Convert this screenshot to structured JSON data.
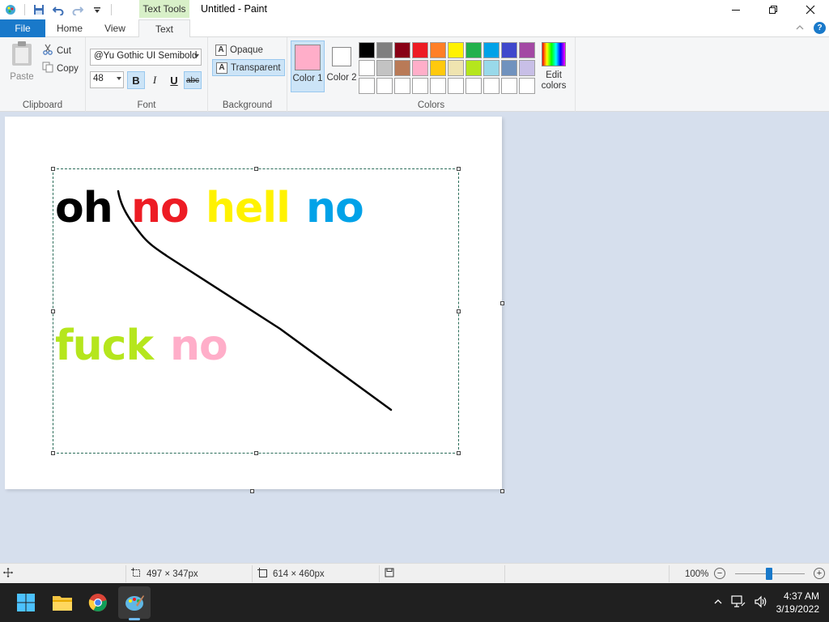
{
  "window": {
    "title": "Untitled - Paint",
    "context_tab": "Text Tools",
    "controls": {
      "minimize": "—",
      "restore": "❐",
      "close": "✕"
    }
  },
  "tabs": {
    "file": "File",
    "home": "Home",
    "view": "View",
    "text": "Text"
  },
  "ribbon": {
    "clipboard": {
      "label": "Clipboard",
      "paste": "Paste",
      "cut": "Cut",
      "copy": "Copy"
    },
    "font": {
      "label": "Font",
      "family": "@Yu Gothic UI Semibold",
      "size": "48",
      "bold": "B",
      "italic": "I",
      "underline": "U",
      "strikethrough": "abc"
    },
    "background": {
      "label": "Background",
      "opaque": "Opaque",
      "transparent": "Transparent",
      "selected": "transparent"
    },
    "colors": {
      "label": "Colors",
      "color1_label": "Color 1",
      "color2_label": "Color 2",
      "color1": "#ffaec9",
      "color2": "#ffffff",
      "edit_colors": "Edit colors",
      "palette": [
        "#000000",
        "#7f7f7f",
        "#880015",
        "#ed1c24",
        "#ff7f27",
        "#fff200",
        "#22b14c",
        "#00a2e8",
        "#3f48cc",
        "#a349a4",
        "#ffffff",
        "#c3c3c3",
        "#b97a57",
        "#ffaec9",
        "#ffc90e",
        "#efe4b0",
        "#b5e61d",
        "#99d9ea",
        "#7092be",
        "#c8bfe7",
        "#ffffff",
        "#ffffff",
        "#ffffff",
        "#ffffff",
        "#ffffff",
        "#ffffff",
        "#ffffff",
        "#ffffff",
        "#ffffff",
        "#ffffff"
      ]
    }
  },
  "canvas": {
    "lines": [
      [
        {
          "text": "oh",
          "color": "#000000"
        },
        {
          "text": "no",
          "color": "#ed1c24"
        },
        {
          "text": "hell",
          "color": "#fff200"
        },
        {
          "text": "no",
          "color": "#00a2e8"
        }
      ],
      [
        {
          "text": "fuck",
          "color": "#b5e61d"
        },
        {
          "text": "no",
          "color": "#ffaec9"
        }
      ]
    ],
    "stroke_color": "#000000"
  },
  "status": {
    "selection_size": "497 × 347px",
    "canvas_size": "614 × 460px",
    "zoom": "100%",
    "zoom_minus": "−",
    "zoom_plus": "+"
  },
  "taskbar": {
    "time": "4:37 AM",
    "date": "3/19/2022",
    "apps": [
      "start-icon",
      "file-explorer-icon",
      "chrome-icon",
      "paint-icon"
    ]
  }
}
